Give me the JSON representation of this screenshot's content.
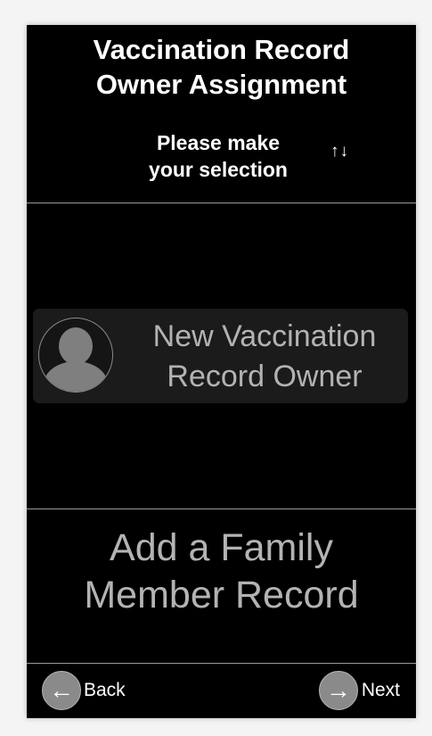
{
  "header": {
    "title_line1": "Vaccination Record",
    "title_line2": "Owner Assignment",
    "subtitle_line1": "Please make",
    "subtitle_line2": "your selection",
    "sort_icon": "↑↓"
  },
  "owner_option": {
    "label_line1": "New Vaccination",
    "label_line2": "Record Owner",
    "icon": "person-avatar-icon"
  },
  "family_option": {
    "label_line1": "Add a Family",
    "label_line2": "Member Record"
  },
  "footer": {
    "back_label": "Back",
    "back_icon": "←",
    "next_label": "Next",
    "next_icon": "→"
  },
  "colors": {
    "background": "#000000",
    "title_text": "#ffffff",
    "option_text": "#b3b3b3",
    "divider": "#9a9a9a",
    "button_circle": "#8a8a8a"
  }
}
